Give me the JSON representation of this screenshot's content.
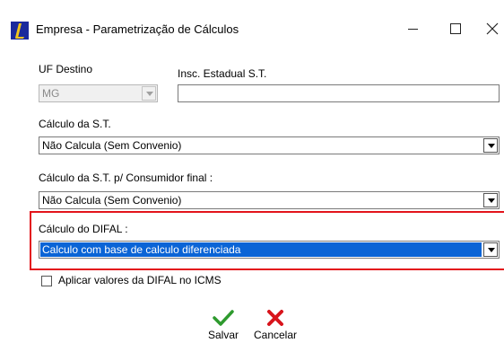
{
  "window": {
    "title": "Empresa - Parametrização de Cálculos",
    "controls": {
      "minimize": "—",
      "maximize": "□",
      "close": "✕"
    }
  },
  "fields": {
    "uf_destino": {
      "label": "UF Destino",
      "value": "MG",
      "disabled": true
    },
    "insc_estadual": {
      "label": "Insc. Estadual S.T.",
      "value": ""
    },
    "calculo_st": {
      "label": "Cálculo da S.T.",
      "value": "Não Calcula (Sem Convenio)"
    },
    "calculo_st_consumidor": {
      "label": "Cálculo da S.T. p/ Consumidor final :",
      "value": "Não Calcula (Sem Convenio)"
    },
    "calculo_difal": {
      "label": "Cálculo do DIFAL :",
      "value": "Calculo com base de calculo diferenciada",
      "highlighted": true
    },
    "aplicar_difal": {
      "label": "Aplicar valores da DIFAL no ICMS",
      "checked": false
    }
  },
  "actions": {
    "save": {
      "label": "Salvar",
      "icon": "green-check-icon",
      "color": "#2e9a2e"
    },
    "cancel": {
      "label": "Cancelar",
      "icon": "red-x-icon",
      "color": "#d8141c"
    }
  },
  "colors": {
    "highlight_border": "#e3141c",
    "selection": "#0a64d6",
    "app_icon": "#1a2a9c"
  }
}
